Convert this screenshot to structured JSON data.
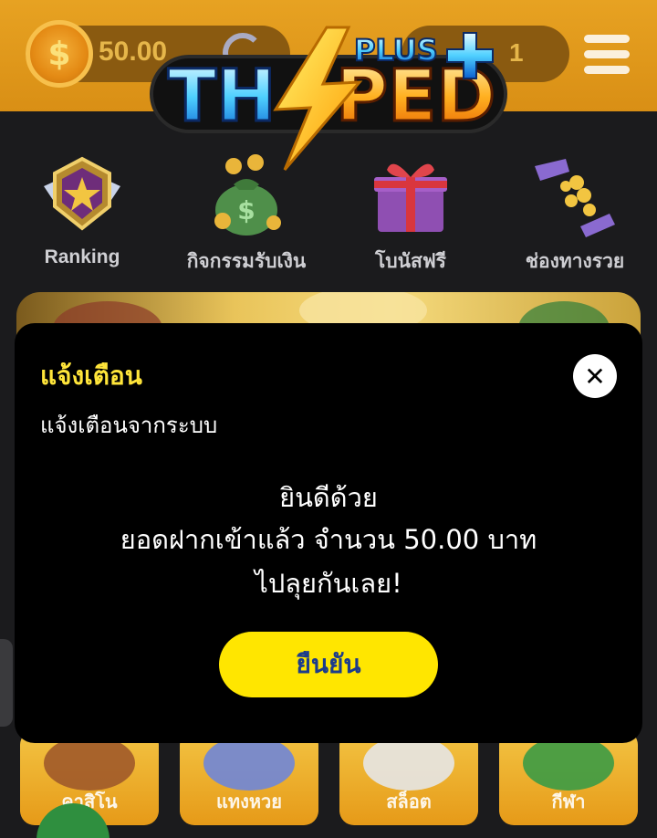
{
  "header": {
    "balance": "50.00",
    "coin_symbol": "$",
    "right_count": "1",
    "accent": "#e7a222"
  },
  "logo": {
    "text_left": "TH",
    "text_right": "PED",
    "plus": "PLUS"
  },
  "quick_nav": [
    {
      "label": "Ranking",
      "icon": "ranking-badge-icon"
    },
    {
      "label": "กิจกรรมรับเงิน",
      "icon": "money-bag-icon"
    },
    {
      "label": "โบนัสฟรี",
      "icon": "gift-box-icon"
    },
    {
      "label": "ช่องทางรวย",
      "icon": "coins-hand-icon"
    }
  ],
  "tiles": [
    {
      "label": "คาสิโน"
    },
    {
      "label": "แทงหวย"
    },
    {
      "label": "สล็อต"
    },
    {
      "label": "กีฬา"
    }
  ],
  "modal": {
    "title": "แจ้งเตือน",
    "subtitle": "แจ้งเตือนจากระบบ",
    "line1": "ยินดีด้วย",
    "line2": "ยอดฝากเข้าแล้ว จำนวน 50.00 บาท",
    "line3": "ไปลุยกันเลย!",
    "confirm": "ยืนยัน",
    "close_symbol": "✕",
    "title_color": "#ffe53a",
    "button_color": "#ffe600"
  }
}
